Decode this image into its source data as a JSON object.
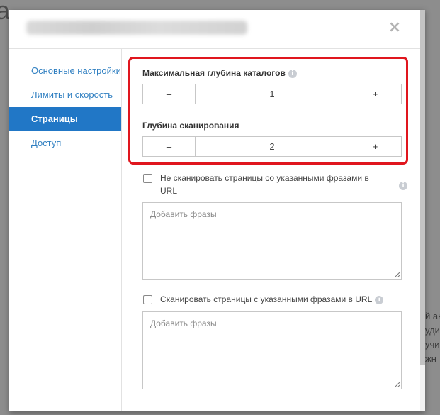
{
  "background": {
    "title_char": "а",
    "side_lines": [
      "й ак",
      "уди",
      "учи",
      "жн"
    ]
  },
  "header": {
    "close_glyph": "×"
  },
  "sidebar": {
    "items": [
      {
        "label": "Основные настройки",
        "active": false
      },
      {
        "label": "Лимиты и скорость",
        "active": false
      },
      {
        "label": "Страницы",
        "active": true
      },
      {
        "label": "Доступ",
        "active": false
      }
    ]
  },
  "content": {
    "max_depth": {
      "label": "Максимальная глубина каталогов",
      "value": "1",
      "minus": "–",
      "plus": "+",
      "info": "i"
    },
    "scan_depth": {
      "label": "Глубина сканирования",
      "value": "2",
      "minus": "–",
      "plus": "+"
    },
    "exclude": {
      "label_line1": "Не сканировать страницы со указанными фразами в",
      "label_line2": "URL",
      "checked": false,
      "placeholder": "Добавить фразы",
      "info": "i"
    },
    "include": {
      "label": "Сканировать страницы с указанными фразами в URL",
      "checked": false,
      "placeholder": "Добавить фразы",
      "info": "i"
    }
  },
  "colors": {
    "accent": "#2177c6",
    "highlight": "#e0161e",
    "link": "#2f7fc1"
  }
}
